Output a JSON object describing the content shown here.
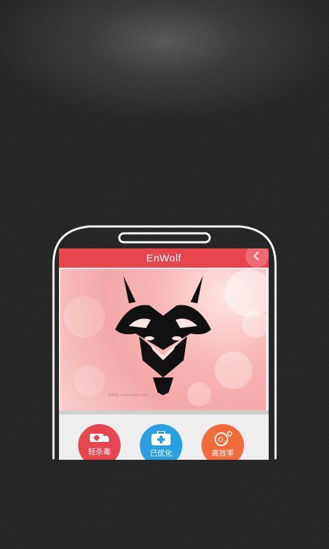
{
  "app": {
    "title": "EnWolf",
    "accent": "#e8464e"
  },
  "header": {
    "back_icon": "chevron-left-icon"
  },
  "banner": {
    "caption": "谷歌客 rendu dauy rete"
  },
  "features": [
    {
      "label": "轻杀毒",
      "icon": "ambulance-icon",
      "color": "#e8464e"
    },
    {
      "label": "已优化",
      "icon": "first-aid-kit-icon",
      "color": "#2aa0e0"
    },
    {
      "label": "高效率",
      "icon": "oxygen-icon",
      "color": "#f26b3a"
    }
  ]
}
